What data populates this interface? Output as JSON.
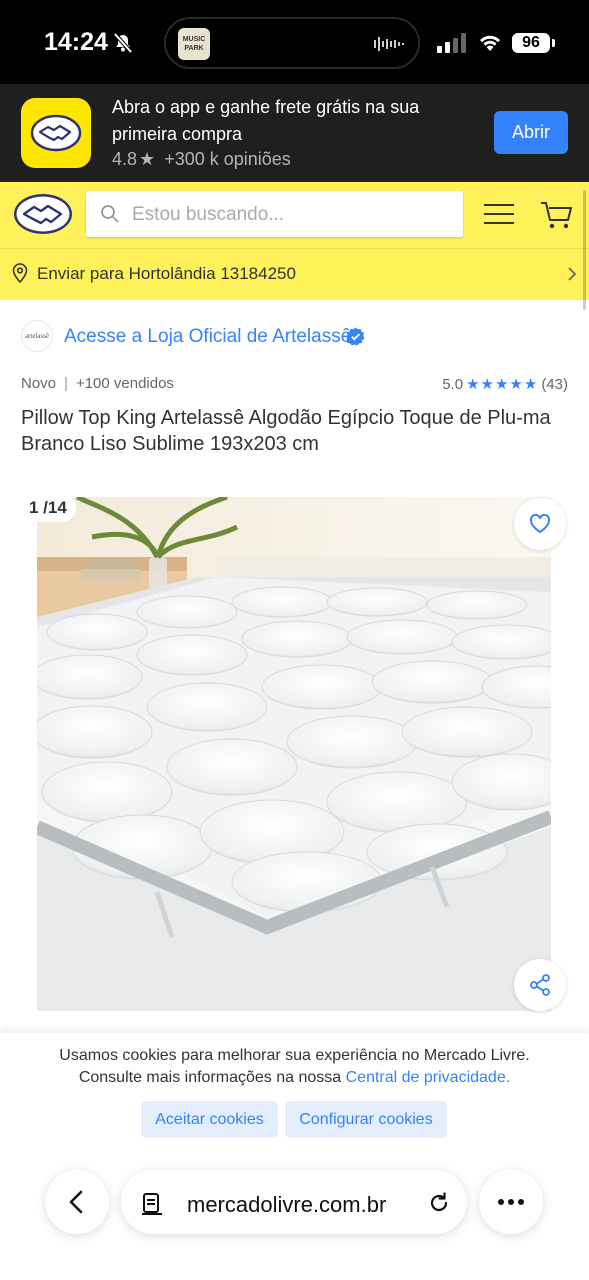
{
  "status_bar": {
    "time": "14:24",
    "battery": "96",
    "island_thumb_text": "MUSIC PARK"
  },
  "app_banner": {
    "message": "Abra o app e ganhe frete grátis na sua primeira compra",
    "rating": "4.8",
    "reviews": "+300 k opiniões",
    "open_label": "Abrir"
  },
  "header": {
    "search_placeholder": "Estou buscando...",
    "location": "Enviar para Hortolândia 13184250"
  },
  "product": {
    "store_logo_text": "artelassê",
    "store_link": "Acesse a Loja Oficial de Artelassê",
    "condition": "Novo",
    "sold": "+100 vendidos",
    "rating": "5.0",
    "stars": "★★★★★",
    "review_count": "(43)",
    "title": "Pillow Top King Artelassê Algodão Egípcio Toque de Plu-ma Branco Liso Sublime 193x203 cm"
  },
  "gallery": {
    "counter": "1 /14"
  },
  "cookie_banner": {
    "text_line1": "Usamos cookies para melhorar sua experiência no Mercado Livre.",
    "text_line2": "Consulte mais informações na nossa",
    "link": "Central de privacidade.",
    "accept_label": "Aceitar cookies",
    "configure_label": "Configurar cookies"
  },
  "browser": {
    "url": "mercadolivre.com.br"
  },
  "colors": {
    "brand_yellow": "#fff159",
    "accent_blue": "#3483fa",
    "banner_dark": "#1f1f1f"
  }
}
